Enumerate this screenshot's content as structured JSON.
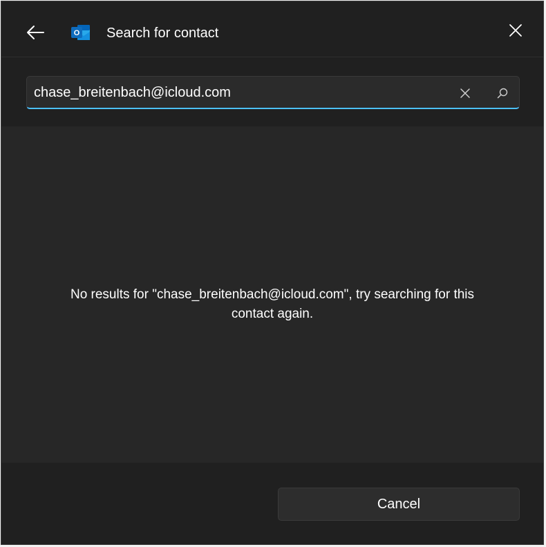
{
  "dialog": {
    "title": "Search for contact",
    "app_icon": "outlook-icon",
    "app_icon_letter": "O",
    "back_icon": "arrow-left-icon",
    "close_icon": "close-icon"
  },
  "search": {
    "value": "chase_breitenbach@icloud.com",
    "clear_icon": "close-icon",
    "search_icon": "search-icon",
    "accent_color": "#4cc2ff"
  },
  "results": {
    "message": "No results for \"chase_breitenbach@icloud.com\", try searching for this contact again."
  },
  "footer": {
    "cancel_label": "Cancel"
  },
  "colors": {
    "background": "#202020",
    "results_background": "#272727",
    "outlook_blue": "#0f6cbd"
  }
}
